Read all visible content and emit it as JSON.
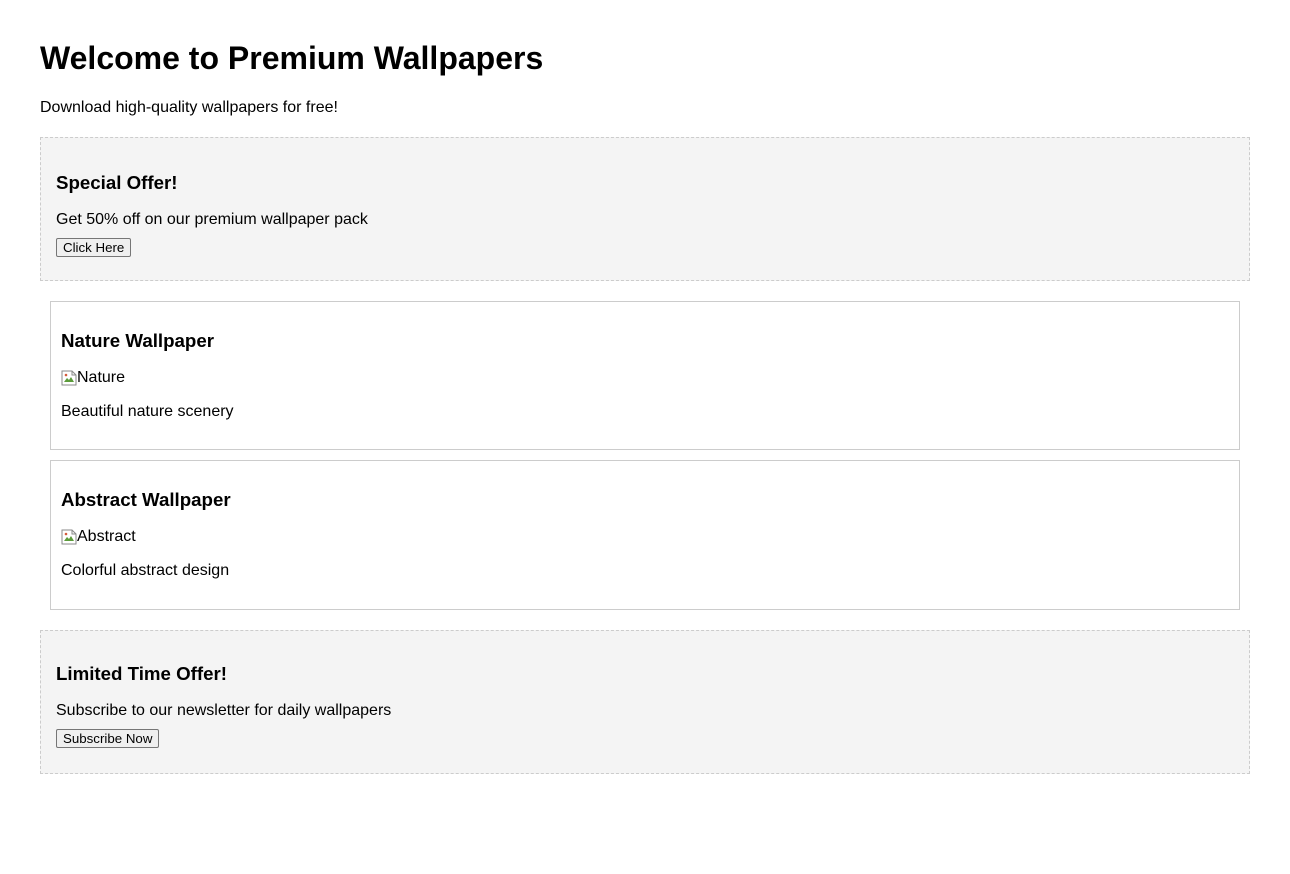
{
  "header": {
    "title": "Welcome to Premium Wallpapers",
    "subtitle": "Download high-quality wallpapers for free!"
  },
  "offers": [
    {
      "title": "Special Offer!",
      "text": "Get 50% off on our premium wallpaper pack",
      "button_label": "Click Here"
    },
    {
      "title": "Limited Time Offer!",
      "text": "Subscribe to our newsletter for daily wallpapers",
      "button_label": "Subscribe Now"
    }
  ],
  "wallpapers": [
    {
      "title": "Nature Wallpaper",
      "image_alt": "Nature",
      "description": "Beautiful nature scenery"
    },
    {
      "title": "Abstract Wallpaper",
      "image_alt": "Abstract",
      "description": "Colorful abstract design"
    }
  ],
  "icons": {
    "broken_image": "broken-image-icon"
  },
  "colors": {
    "offer_background": "#f4f4f4",
    "offer_border": "#cccccc",
    "card_border": "#cccccc"
  }
}
